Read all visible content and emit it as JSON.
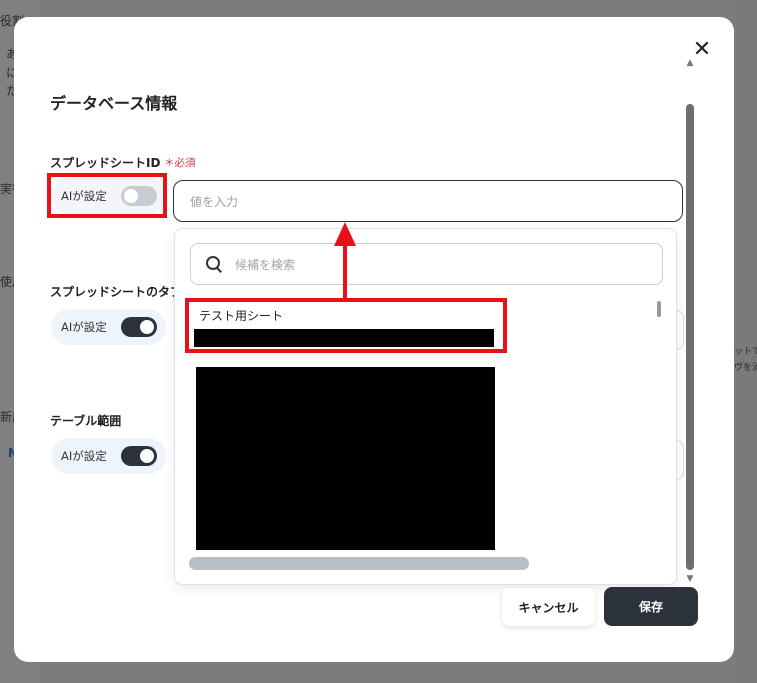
{
  "background": {
    "fragments": [
      "役割",
      "あ",
      "に",
      "た",
      "実行",
      "使用",
      "新原",
      "N",
      "ットで",
      "ヴを消"
    ]
  },
  "modal": {
    "title": "データベース情報",
    "close_glyph": "✕"
  },
  "fields": {
    "spreadsheet_id": {
      "label": "スプレッドシートID",
      "required": "＊必須",
      "ai_label": "AIが設定",
      "ai_enabled": false,
      "input_placeholder": "値を入力"
    },
    "sheet_tab": {
      "label": "スプレッドシートのタブ",
      "ai_label": "AIが設定",
      "ai_enabled": true
    },
    "table_range": {
      "label": "テーブル範囲",
      "ai_label": "AIが設定",
      "ai_enabled": true
    }
  },
  "dropdown": {
    "search_placeholder": "候補を検索",
    "first_option": "テスト用シート"
  },
  "buttons": {
    "cancel": "キャンセル",
    "save": "保存"
  },
  "colors": {
    "highlight": "#e8111a",
    "primary": "#2c323b",
    "required": "#d4344f"
  }
}
